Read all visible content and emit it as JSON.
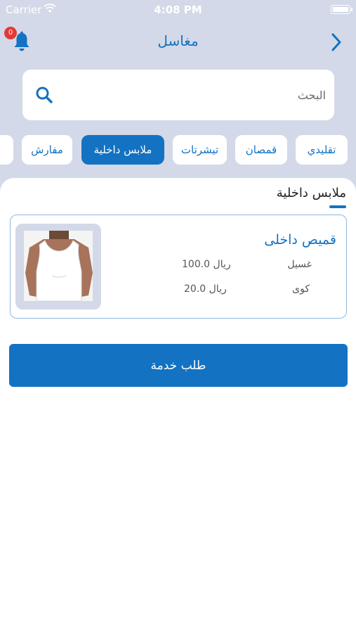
{
  "status_bar": {
    "carrier": "Carrier",
    "time": "4:08 PM"
  },
  "header": {
    "title": "مغاسل",
    "notification_count": "0"
  },
  "search": {
    "placeholder": "البحث",
    "value": ""
  },
  "categories": [
    {
      "label": "تقليدي",
      "active": false
    },
    {
      "label": "قمصان",
      "active": false
    },
    {
      "label": "تيشرتات",
      "active": false
    },
    {
      "label": "ملابس داخلية",
      "active": true
    },
    {
      "label": "مفارش",
      "active": false
    }
  ],
  "section": {
    "title": "ملابس داخلية"
  },
  "product": {
    "name": "قميص داخلى",
    "services": [
      {
        "name": "غسيل",
        "price": "100.0 ريال"
      },
      {
        "name": "كوى",
        "price": "20.0 ريال"
      }
    ]
  },
  "order_button": {
    "label": "طلب خدمة"
  },
  "colors": {
    "accent": "#1372c2",
    "header_bg": "#d3d9e8",
    "badge": "#e53935"
  }
}
